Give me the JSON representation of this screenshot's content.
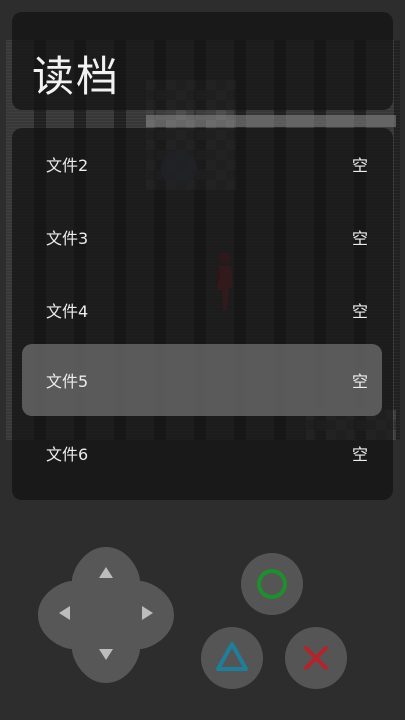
{
  "title": "读档",
  "files": [
    {
      "name": "文件2",
      "status": "空"
    },
    {
      "name": "文件3",
      "status": "空"
    },
    {
      "name": "文件4",
      "status": "空"
    },
    {
      "name": "文件5",
      "status": "空"
    },
    {
      "name": "文件6",
      "status": "空"
    }
  ],
  "selected_file": "文件5",
  "controls": {
    "dpad_icons": [
      "arrow-up-icon",
      "arrow-left-icon",
      "arrow-right-icon",
      "arrow-down-icon"
    ],
    "buttons": [
      {
        "icon": "circle-icon",
        "color": "#1f8f2e"
      },
      {
        "icon": "triangle-icon",
        "color": "#1f7f9a"
      },
      {
        "icon": "cross-icon",
        "color": "#b3242a"
      }
    ]
  },
  "colors": {
    "background": "#2d2d2d",
    "panel": "#121212",
    "selected_row": "#5f5f5f",
    "text": "#ececec"
  }
}
